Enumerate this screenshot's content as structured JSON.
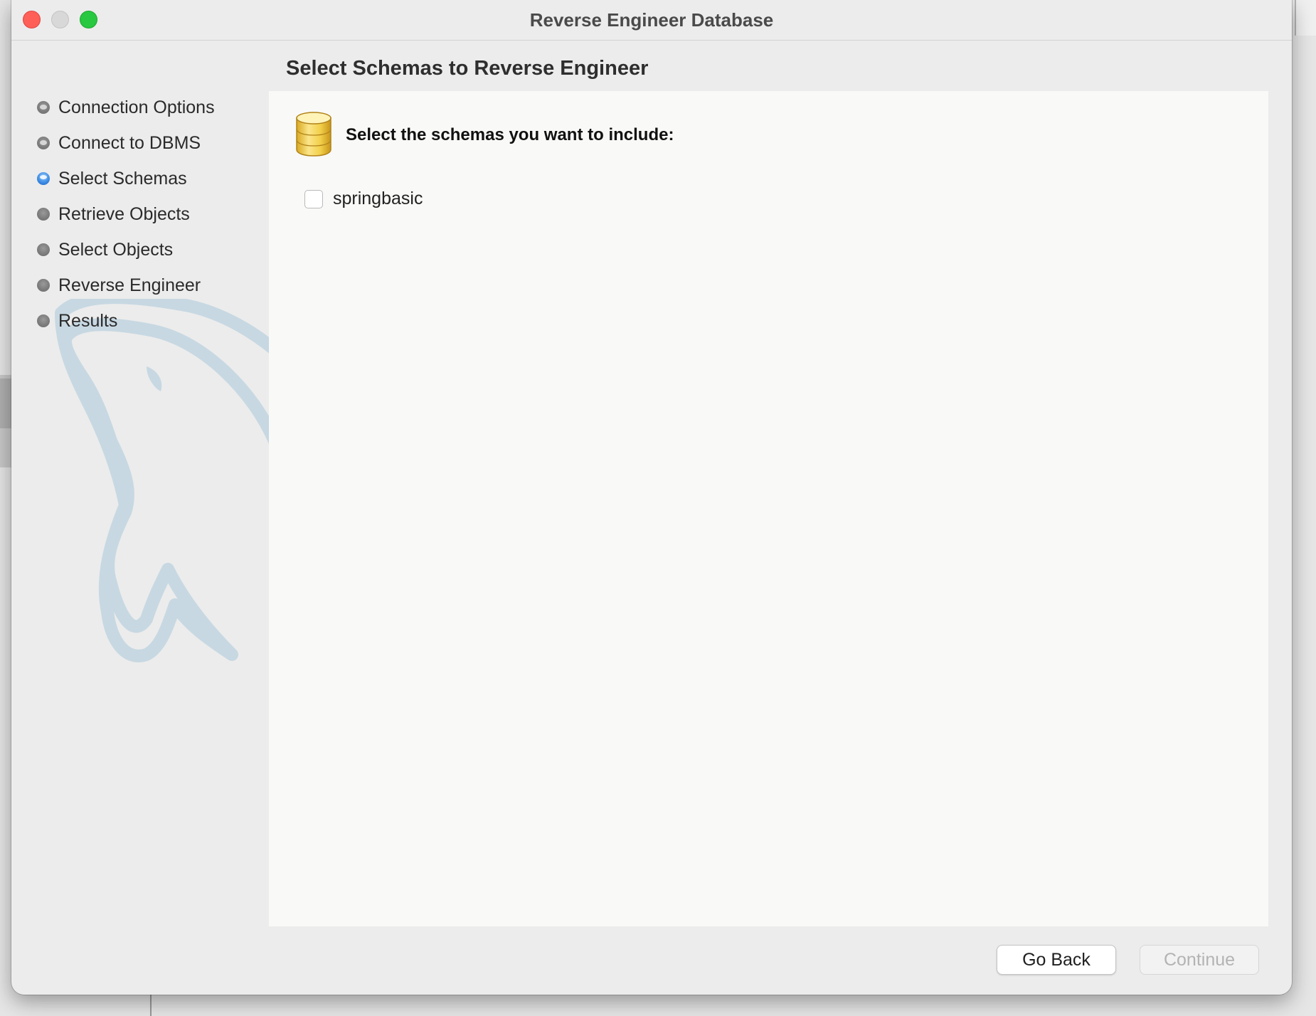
{
  "window": {
    "title": "Reverse Engineer Database"
  },
  "page": {
    "heading": "Select Schemas to Reverse Engineer",
    "instruction": "Select the schemas you want to include:"
  },
  "steps": [
    {
      "label": "Connection Options",
      "state": "done"
    },
    {
      "label": "Connect to DBMS",
      "state": "done"
    },
    {
      "label": "Select Schemas",
      "state": "current"
    },
    {
      "label": "Retrieve Objects",
      "state": "pending"
    },
    {
      "label": "Select Objects",
      "state": "pending"
    },
    {
      "label": "Reverse Engineer",
      "state": "pending"
    },
    {
      "label": "Results",
      "state": "pending"
    }
  ],
  "schemas": [
    {
      "name": "springbasic",
      "checked": false
    }
  ],
  "buttons": {
    "back_label": "Go Back",
    "continue_label": "Continue",
    "continue_enabled": false
  },
  "icons": {
    "database": "database-icon",
    "watermark": "dolphin-watermark"
  },
  "colors": {
    "close": "#fe5f57",
    "minimize": "#d8d8d8",
    "zoom": "#28c840",
    "current_step": "#3d8de6",
    "database_icon": "#f2cf4a"
  }
}
